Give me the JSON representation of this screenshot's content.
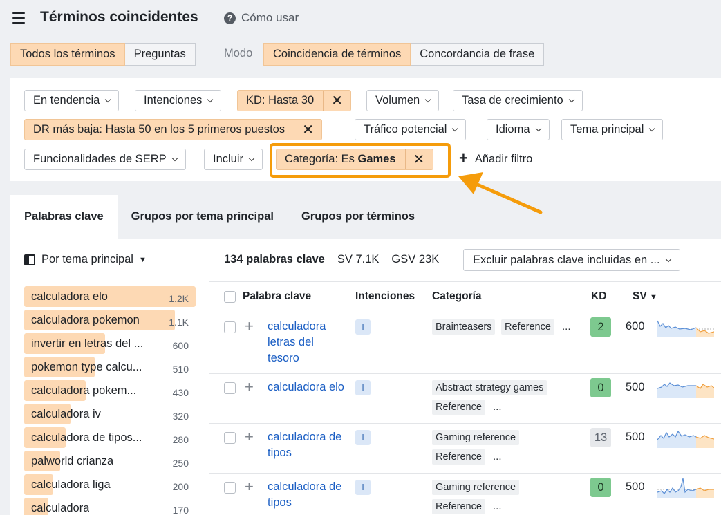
{
  "header": {
    "title": "Términos coincidentes",
    "help_label": "Cómo usar"
  },
  "tabs_terms": [
    "Todos los términos",
    "Preguntas"
  ],
  "modo_label": "Modo",
  "tabs_mode": [
    "Coincidencia de términos",
    "Concordancia de frase"
  ],
  "filters": {
    "trend": "En tendencia",
    "intents": "Intenciones",
    "kd": "KD: Hasta 30",
    "volume": "Volumen",
    "growth": "Tasa de crecimiento",
    "dr": "DR más baja: Hasta 50 en los 5 primeros puestos",
    "traffic": "Tráfico potencial",
    "language": "Idioma",
    "topic": "Tema principal",
    "serp": "Funcionalidades de SERP",
    "include": "Incluir",
    "category_prefix": "Categoría: Es ",
    "category_value": "Games",
    "add_filter": "Añadir filtro"
  },
  "result_tabs": [
    "Palabras clave",
    "Grupos por tema principal",
    "Grupos por términos"
  ],
  "sidebar": {
    "group_by": "Por tema principal",
    "items": [
      {
        "label": "calculadora elo",
        "count": "1.2K",
        "fill": 1.0
      },
      {
        "label": "calculadora pokemon",
        "count": "1.1K",
        "fill": 0.88
      },
      {
        "label": "invertir en letras del ...",
        "count": "600",
        "fill": 0.47
      },
      {
        "label": "pokemon type calcu...",
        "count": "510",
        "fill": 0.41
      },
      {
        "label": "calculadora pokem...",
        "count": "430",
        "fill": 0.36
      },
      {
        "label": "calculadora iv",
        "count": "320",
        "fill": 0.27
      },
      {
        "label": "calculadora de tipos...",
        "count": "280",
        "fill": 0.24
      },
      {
        "label": "palworld crianza",
        "count": "250",
        "fill": 0.21
      },
      {
        "label": "calculadora liga",
        "count": "200",
        "fill": 0.17
      },
      {
        "label": "calculadora",
        "count": "170",
        "fill": 0.14
      }
    ]
  },
  "stats": {
    "keywords": "134 palabras clave",
    "sv": "SV 7.1K",
    "gsv": "GSV 23K",
    "exclude": "Excluir palabras clave incluidas en ..."
  },
  "table": {
    "headers": {
      "keyword": "Palabra clave",
      "intents": "Intenciones",
      "category": "Categoría",
      "kd": "KD",
      "sv": "SV"
    },
    "rows": [
      {
        "keyword": "calculadora letras del tesoro",
        "intent": "I",
        "categories": [
          "Brainteasers",
          "Reference"
        ],
        "more": "...",
        "kd": "2",
        "kd_color": "#7dc98f",
        "sv": "600"
      },
      {
        "keyword": "calculadora elo",
        "intent": "I",
        "categories": [
          "Abstract strategy games",
          "Reference"
        ],
        "more": "...",
        "kd": "0",
        "kd_color": "#7dc98f",
        "sv": "500"
      },
      {
        "keyword": "calculadora de tipos",
        "intent": "I",
        "categories": [
          "Gaming reference",
          "Reference"
        ],
        "more": "...",
        "kd": "13",
        "kd_color": "#e6e8eb",
        "sv": "500"
      },
      {
        "keyword": "calculadora de tipos",
        "intent": "I",
        "categories": [
          "Gaming reference",
          "Reference"
        ],
        "more": "...",
        "kd": "0",
        "kd_color": "#7dc98f",
        "sv": "500"
      }
    ]
  },
  "colors": {
    "accent": "#fdd9b4",
    "highlight": "#f59c0b",
    "link": "#1c5fc4"
  }
}
